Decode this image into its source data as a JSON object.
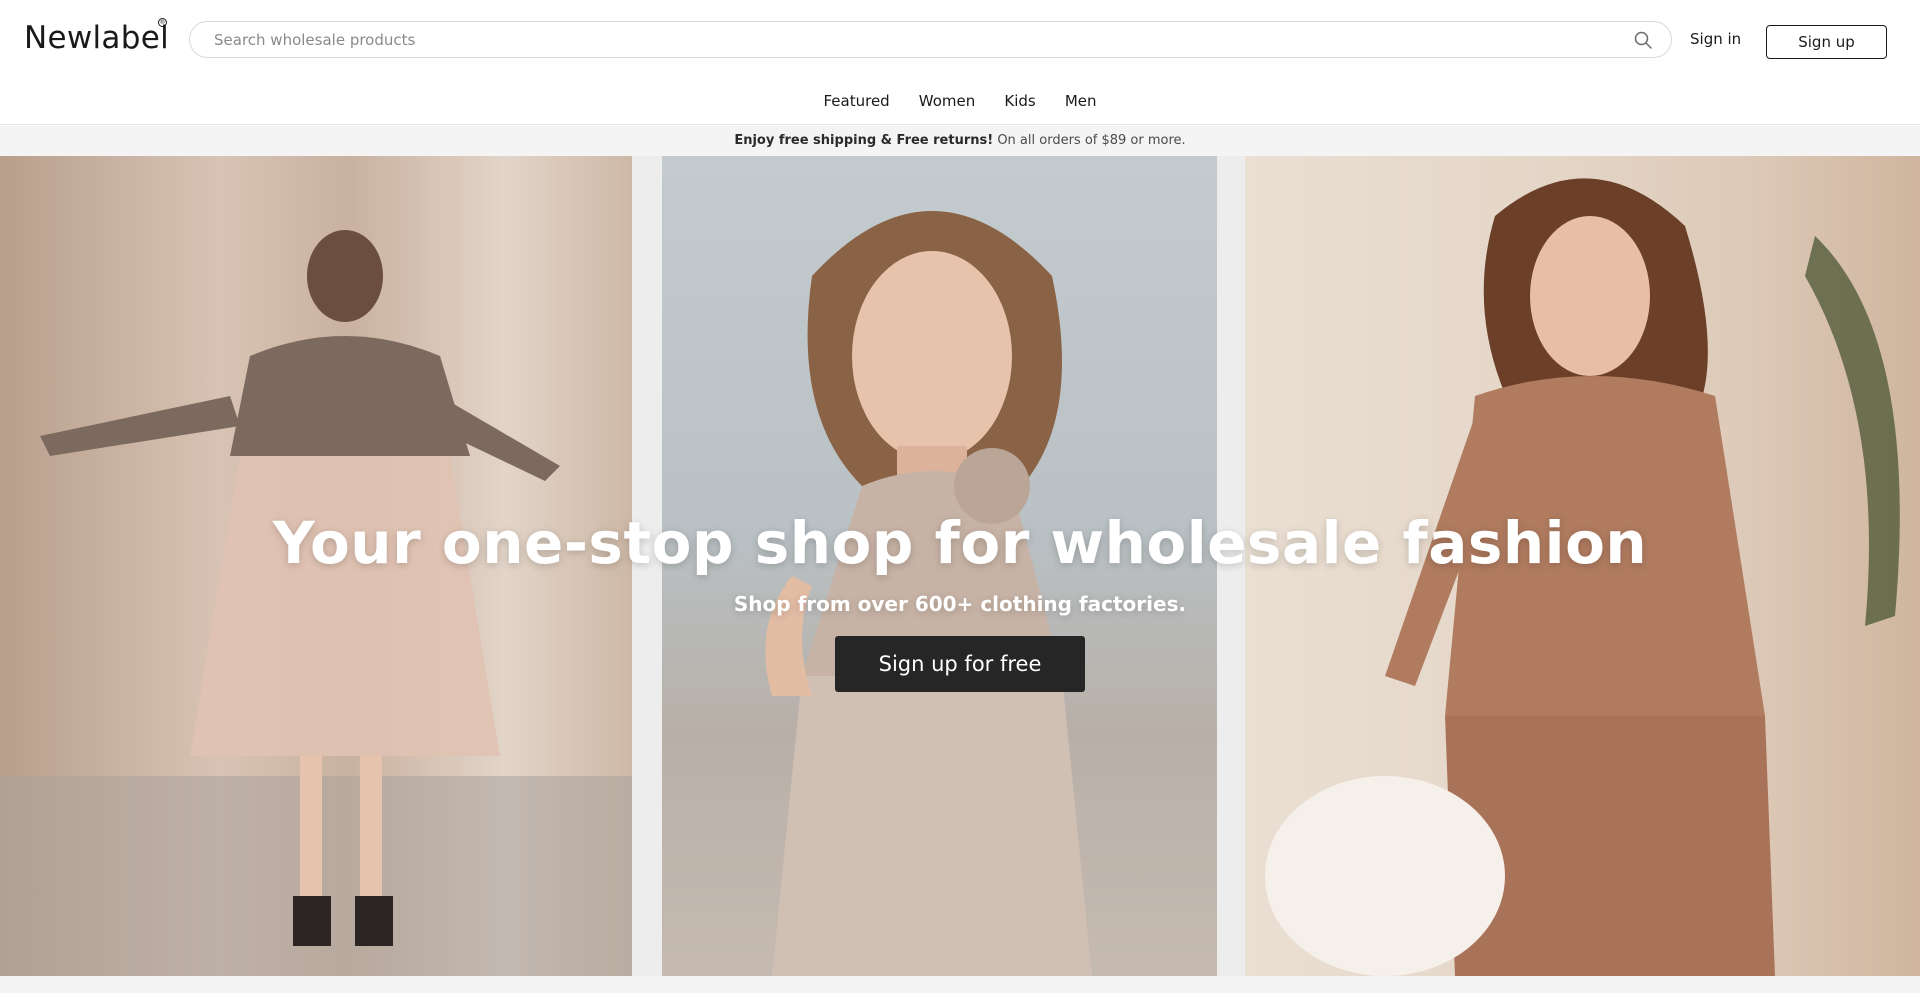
{
  "header": {
    "logo": "Newlabel",
    "logo_mark": "®",
    "search_placeholder": "Search wholesale products",
    "signin_label": "Sign in",
    "signup_label": "Sign up"
  },
  "nav": {
    "items": [
      {
        "label": "Featured"
      },
      {
        "label": "Women"
      },
      {
        "label": "Kids"
      },
      {
        "label": "Men"
      }
    ]
  },
  "promo": {
    "bold": "Enjoy free shipping & Free returns!",
    "rest": "On all orders of $89 or more."
  },
  "hero": {
    "title": "Your one-stop shop for wholesale fashion",
    "subtitle": "Shop from over 600+ clothing factories.",
    "cta_label": "Sign up for free"
  },
  "colors": {
    "accent": "#262626",
    "promo_bg": "#f4f4f4"
  },
  "icons": [
    "search-icon"
  ]
}
